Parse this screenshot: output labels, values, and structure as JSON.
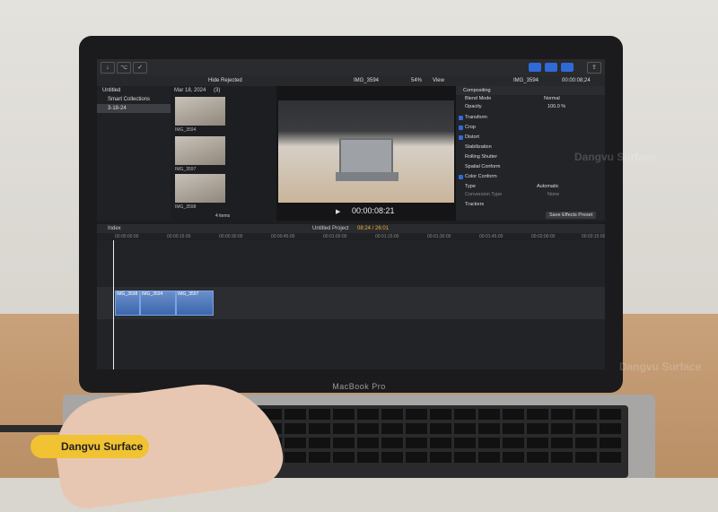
{
  "ui": {
    "browser_filter": "Hide Rejected",
    "viewer_clip_name": "IMG_3594",
    "zoom": "54%",
    "view_menu": "View",
    "inspector_clip_name": "IMG_3594",
    "inspector_duration": "00:00:08;24",
    "libraries": [
      {
        "label": "Untitled"
      },
      {
        "label": "Smart Collections"
      },
      {
        "label": "3-18-24"
      }
    ],
    "event_date": "Mar 18, 2024",
    "event_count": "(3)",
    "thumbnails": [
      "IMG_3594",
      "IMG_3597",
      "IMG_3598"
    ],
    "items_count": "4 items",
    "timecode": "00:00:08:21",
    "inspector": {
      "section_compositing": "Compositing",
      "blend_mode_label": "Blend Mode",
      "blend_mode_value": "Normal",
      "opacity_label": "Opacity",
      "opacity_value": "100.0 %",
      "transform": "Transform",
      "crop": "Crop",
      "distort": "Distort",
      "stabilization": "Stabilization",
      "rolling_shutter": "Rolling Shutter",
      "spatial_conform": "Spatial Conform",
      "color_conform": "Color Conform",
      "type_label": "Type",
      "type_value": "Automatic",
      "conversion_label": "Conversion Type",
      "conversion_value": "None",
      "trackers": "Trackers",
      "save_preset": "Save Effects Preset"
    },
    "timeline": {
      "index": "Index",
      "project": "Untitled Project",
      "position": "08:24 / 26:01",
      "ruler_ticks": [
        "00:00:00:00",
        "00:00:15:00",
        "00:00:30:00",
        "00:00:45:00",
        "00:01:00:00",
        "00:01:15:00",
        "00:01:30:00",
        "00:01:45:00",
        "00:02:00:00",
        "00:02:15:00"
      ],
      "clips": [
        "IMG_3598",
        "IMG_3594",
        "IMG_3597"
      ]
    }
  },
  "laptop_label": "MacBook Pro",
  "brand": "Dangvu Surface",
  "watermark": "Dangvu Surface"
}
